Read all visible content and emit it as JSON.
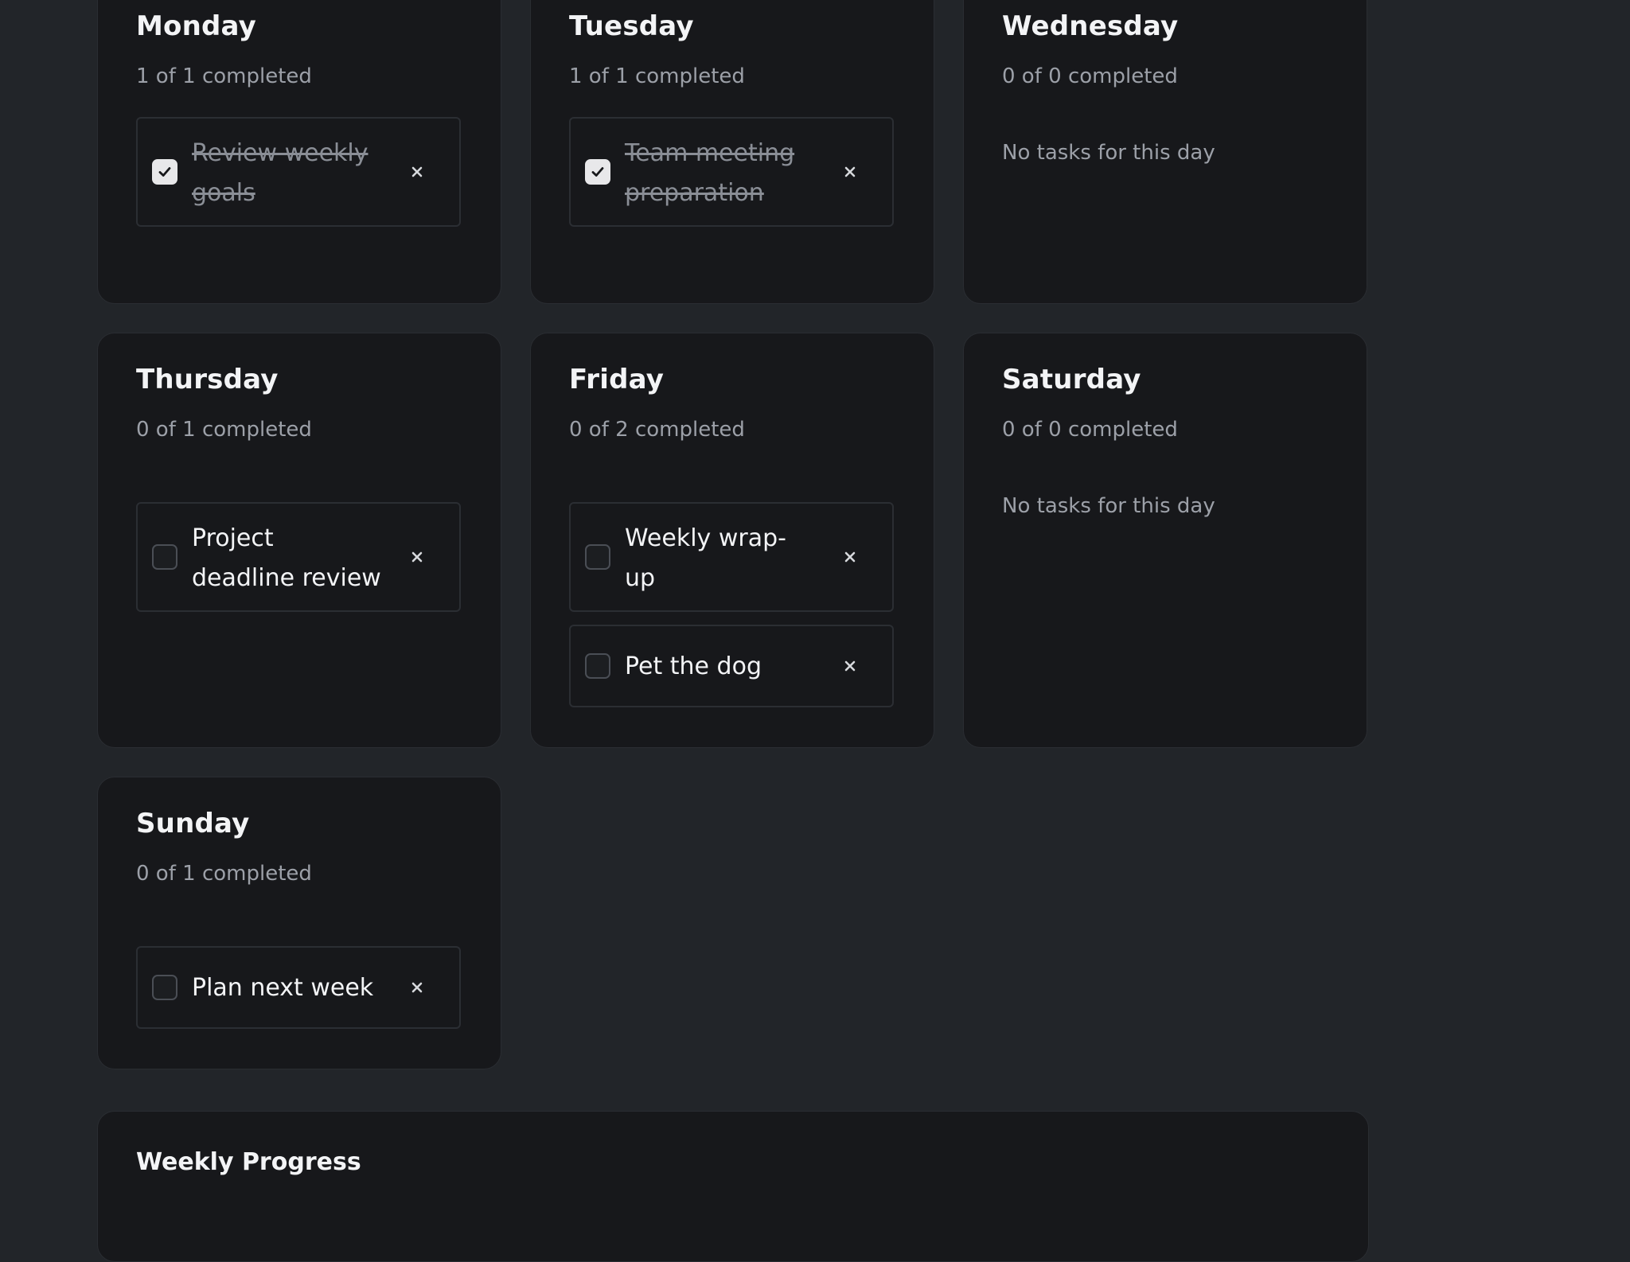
{
  "days": [
    {
      "title": "Monday",
      "subtitle": "1 of 1 completed",
      "tasks": [
        {
          "text": "Review weekly goals",
          "completed": true
        }
      ]
    },
    {
      "title": "Tuesday",
      "subtitle": "1 of 1 completed",
      "tasks": [
        {
          "text": "Team meeting preparation",
          "completed": true
        }
      ]
    },
    {
      "title": "Wednesday",
      "subtitle": "0 of 0 completed",
      "empty_text": "No tasks for this day",
      "tasks": []
    },
    {
      "title": "Thursday",
      "subtitle": "0 of 1 completed",
      "tasks": [
        {
          "text": "Project deadline review",
          "completed": false
        }
      ]
    },
    {
      "title": "Friday",
      "subtitle": "0 of 2 completed",
      "tasks": [
        {
          "text": "Weekly wrap-up",
          "completed": false
        },
        {
          "text": "Pet the dog",
          "completed": false
        }
      ]
    },
    {
      "title": "Saturday",
      "subtitle": "0 of 0 completed",
      "empty_text": "No tasks for this day",
      "tasks": []
    },
    {
      "title": "Sunday",
      "subtitle": "0 of 1 completed",
      "tasks": [
        {
          "text": "Plan next week",
          "completed": false
        }
      ]
    }
  ],
  "progress": {
    "title": "Weekly Progress"
  },
  "icons": {
    "check": "check-icon",
    "remove": "close-icon"
  },
  "colors": {
    "page_background": "#222529",
    "card_background": "#17181b",
    "checked_box": "#e8e8ea",
    "muted_text": "#9ca0a8"
  }
}
